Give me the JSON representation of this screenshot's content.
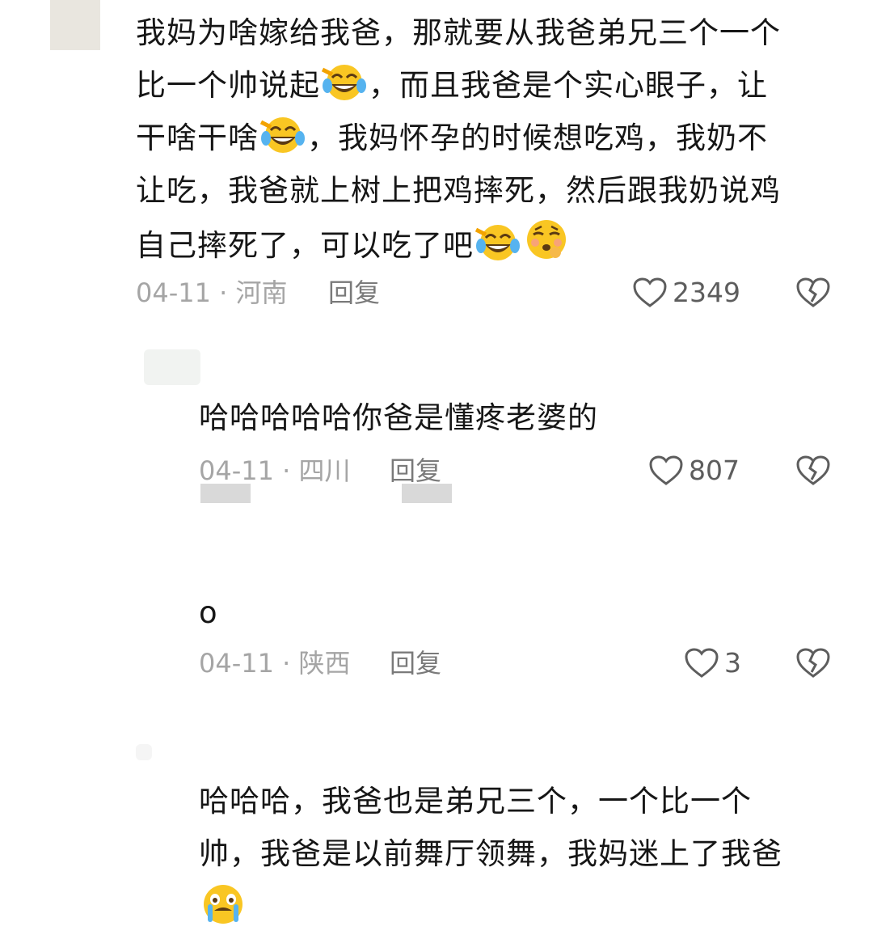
{
  "comments": [
    {
      "lines": [
        [
          "我妈为啥嫁给我爸，那就要从我爸弟兄三个一个"
        ],
        [
          "比一个帅说起",
          "emoji:laugh-cry",
          "，而且我爸是个实心眼子，让"
        ],
        [
          "干啥干啥",
          "emoji:laugh-cry",
          "，我妈怀孕的时候想吃鸡，我奶不"
        ],
        [
          "让吃，我爸就上树上把鸡摔死，然后跟我奶说鸡"
        ],
        [
          "自己摔死了，可以吃了吧",
          "emoji:laugh-cry",
          "emoji:tired-face"
        ]
      ],
      "line1": "我妈为啥嫁给我爸，那就要从我爸弟兄三个一个",
      "line2a": "比一个帅说起",
      "line2b": "，而且我爸是个实心眼子，让",
      "line3a": "干啥干啥",
      "line3b": "，我妈怀孕的时候想吃鸡，我奶不",
      "line4": "让吃，我爸就上树上把鸡摔死，然后跟我奶说鸡",
      "line5": "自己摔死了，可以吃了吧",
      "meta": "04-11 · 河南",
      "reply": "回复",
      "likes": "2349"
    },
    {
      "line1": "哈哈哈哈哈你爸是懂疼老婆的",
      "meta": "04-11 · 四川",
      "reply": "回复",
      "likes": "807"
    },
    {
      "line1": "o",
      "meta": "04-11 · 陕西",
      "reply": "回复",
      "likes": "3"
    },
    {
      "line1": "哈哈哈，我爸也是弟兄三个，一个比一个",
      "line2": "帅，我爸是以前舞厅领舞，我妈迷上了我爸"
    }
  ],
  "icons": {
    "like": "heart-outline-icon",
    "dislike": "broken-heart-icon",
    "emoji_a": "laugh-cry-emoji",
    "emoji_b": "tired-face-emoji",
    "emoji_c": "crying-face-emoji"
  },
  "colors": {
    "text": "#161616",
    "meta": "#a5a5a5",
    "emoji_yellow": "#f9c623"
  }
}
